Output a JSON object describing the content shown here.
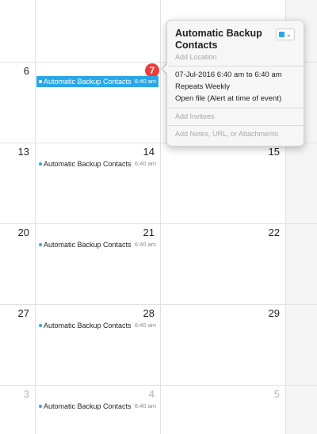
{
  "colors": {
    "accent": "#2aa7e8",
    "today": "#f03c3c"
  },
  "weeks": [
    {
      "days": [
        {
          "number": "",
          "dim": false
        },
        {
          "number": "",
          "dim": false
        },
        {
          "number": "",
          "dim": false
        }
      ]
    },
    {
      "days": [
        {
          "number": "6",
          "dim": false
        },
        {
          "number": "7",
          "today": true
        },
        {
          "number": "",
          "dim": false
        }
      ]
    },
    {
      "days": [
        {
          "number": "13",
          "dim": false
        },
        {
          "number": "14",
          "dim": false
        },
        {
          "number": "15",
          "dim": false
        }
      ]
    },
    {
      "days": [
        {
          "number": "20",
          "dim": false
        },
        {
          "number": "21",
          "dim": false
        },
        {
          "number": "22",
          "dim": false
        }
      ]
    },
    {
      "days": [
        {
          "number": "27",
          "dim": false
        },
        {
          "number": "28",
          "dim": false
        },
        {
          "number": "29",
          "dim": false
        }
      ]
    },
    {
      "days": [
        {
          "number": "3",
          "dim": true
        },
        {
          "number": "4",
          "dim": true
        },
        {
          "number": "5",
          "dim": true
        }
      ]
    }
  ],
  "events": [
    {
      "title": "Automatic Backup Contacts",
      "time": "6:40 am",
      "selected": true
    },
    {
      "title": "Automatic Backup Contacts",
      "time": "6:40 am",
      "selected": false
    },
    {
      "title": "Automatic Backup Contacts",
      "time": "6:40 am",
      "selected": false
    },
    {
      "title": "Automatic Backup Contacts",
      "time": "6:40 am",
      "selected": false
    },
    {
      "title": "Automatic Backup Contacts",
      "time": "6:40 am",
      "selected": false
    }
  ],
  "popover": {
    "title": "Automatic Backup Contacts",
    "location_placeholder": "Add Location",
    "date_time": "07-Jul-2016  6:40 am to 6:40 am",
    "repeat": "Repeats Weekly",
    "alert": "Open file (Alert at time of event)",
    "invitees_placeholder": "Add Invitees",
    "notes_placeholder": "Add Notes, URL, or Attachments",
    "calendar_color_icon": "calendar-color-swatch-icon",
    "chevron_icon": "chevron-down-icon"
  }
}
